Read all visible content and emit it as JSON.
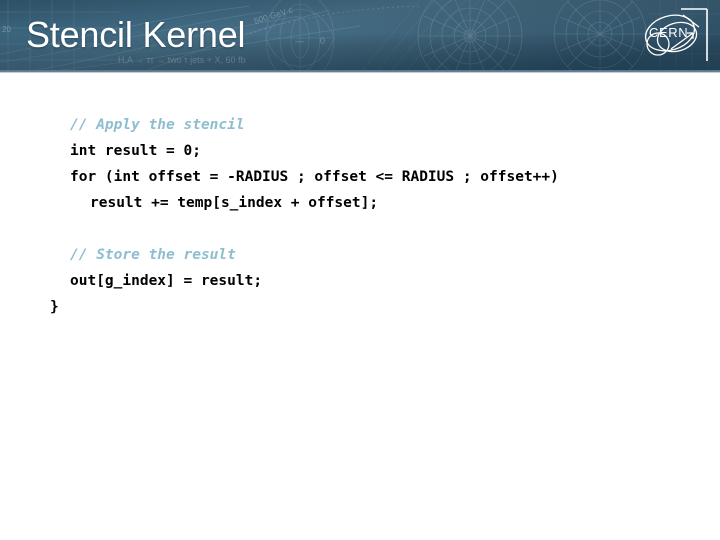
{
  "slide": {
    "title": "Stencil Kernel",
    "background_color": "#ffffff"
  },
  "header": {
    "title": "Stencil Kernel",
    "background_color": "#2f5570",
    "title_color": "#ffffff",
    "logo_name": "CERN",
    "artwork_caption_top": "500 GeV c",
    "artwork_caption_bottom": "H,A → ττ → two τ jets + X, 60 fb",
    "artwork_axis_label": "20",
    "artwork_zero_label": "0"
  },
  "code": {
    "language": "c",
    "comment_color": "#8fbdd0",
    "text_color": "#000000",
    "lines": [
      {
        "indent": 1,
        "kind": "comment",
        "text": "// Apply the stencil"
      },
      {
        "indent": 1,
        "kind": "code",
        "text": "int result = 0;"
      },
      {
        "indent": 1,
        "kind": "code",
        "text": "for (int offset = -RADIUS ; offset <= RADIUS ; offset++)"
      },
      {
        "indent": 2,
        "kind": "code",
        "text": "result += temp[s_index + offset];"
      },
      {
        "indent": 1,
        "kind": "blank",
        "text": " "
      },
      {
        "indent": 1,
        "kind": "comment",
        "text": "// Store the result"
      },
      {
        "indent": 1,
        "kind": "code",
        "text": "out[g_index] = result;"
      },
      {
        "indent": 0,
        "kind": "code",
        "text": "}"
      }
    ]
  }
}
